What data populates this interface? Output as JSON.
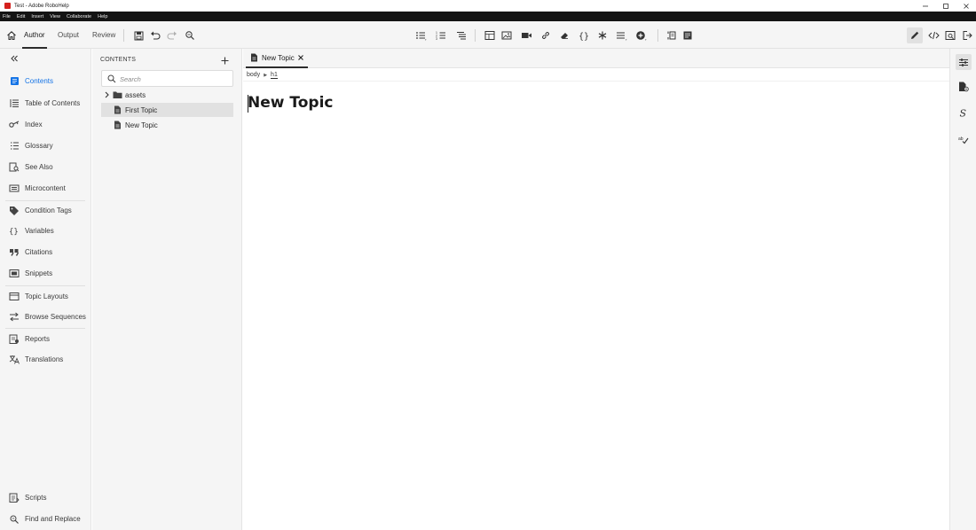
{
  "window": {
    "title": "Test - Adobe RoboHelp"
  },
  "menubar": {
    "items": [
      "File",
      "Edit",
      "Insert",
      "View",
      "Collaborate",
      "Help"
    ]
  },
  "toolbar": {
    "modes": [
      "Author",
      "Output",
      "Review"
    ],
    "active_mode": "Author"
  },
  "leftnav": {
    "items": [
      {
        "label": "Contents",
        "icon": "contents-icon",
        "active": true
      },
      {
        "label": "Table of Contents",
        "icon": "toc-icon"
      },
      {
        "label": "Index",
        "icon": "key-icon"
      },
      {
        "label": "Glossary",
        "icon": "glossary-icon"
      },
      {
        "label": "See Also",
        "icon": "see-also-icon"
      },
      {
        "label": "Microcontent",
        "icon": "microcontent-icon"
      },
      {
        "label": "Condition Tags",
        "icon": "tag-icon"
      },
      {
        "label": "Variables",
        "icon": "braces-icon"
      },
      {
        "label": "Citations",
        "icon": "quote-icon"
      },
      {
        "label": "Snippets",
        "icon": "snippet-icon"
      },
      {
        "label": "Topic Layouts",
        "icon": "layout-icon"
      },
      {
        "label": "Browse Sequences",
        "icon": "sequence-icon"
      },
      {
        "label": "Reports",
        "icon": "reports-icon"
      },
      {
        "label": "Translations",
        "icon": "translate-icon"
      },
      {
        "label": "Scripts",
        "icon": "scripts-icon"
      },
      {
        "label": "Find and Replace",
        "icon": "find-replace-icon"
      }
    ],
    "accent": "#1473e6"
  },
  "contents": {
    "title": "CONTENTS",
    "search_placeholder": "Search",
    "tree": [
      {
        "label": "assets",
        "type": "folder"
      },
      {
        "label": "First Topic",
        "type": "topic",
        "selected": true
      },
      {
        "label": "New Topic",
        "type": "topic"
      }
    ]
  },
  "editor": {
    "tab_label": "New Topic",
    "breadcrumb": [
      "body",
      "h1"
    ],
    "heading": "New Topic"
  }
}
